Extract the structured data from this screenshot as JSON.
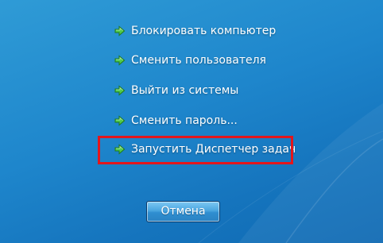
{
  "menu": {
    "items": [
      {
        "label": "Блокировать компьютер",
        "icon": "green-arrow-icon"
      },
      {
        "label": "Сменить пользователя",
        "icon": "green-arrow-icon"
      },
      {
        "label": "Выйти из системы",
        "icon": "green-arrow-icon"
      },
      {
        "label": "Сменить пароль...",
        "icon": "green-arrow-icon"
      },
      {
        "label": "Запустить Диспетчер задач",
        "icon": "green-arrow-icon",
        "highlighted": true
      }
    ]
  },
  "cancel_button": {
    "label": "Отмена"
  },
  "colors": {
    "background": "#1e86cc",
    "highlight_border": "#e3161c",
    "text": "#ffffff",
    "arrow": "#4fc94a"
  }
}
